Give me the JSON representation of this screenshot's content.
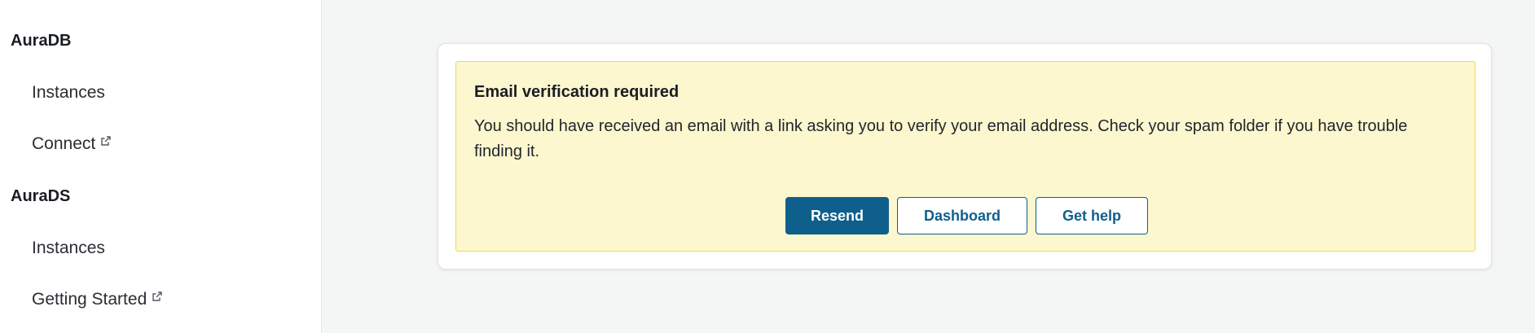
{
  "sidebar": {
    "sections": [
      {
        "heading": "AuraDB",
        "items": [
          {
            "label": "Instances",
            "external": false
          },
          {
            "label": "Connect",
            "external": true
          }
        ]
      },
      {
        "heading": "AuraDS",
        "items": [
          {
            "label": "Instances",
            "external": false
          },
          {
            "label": "Getting Started",
            "external": true
          }
        ]
      }
    ],
    "external_icon": "external-link-icon"
  },
  "main": {
    "banner": {
      "title": "Email verification required",
      "message": "You should have received an email with a link asking you to verify your email address. Check your spam folder if you have trouble finding it.",
      "buttons": {
        "resend": "Resend",
        "dashboard": "Dashboard",
        "help": "Get help"
      }
    }
  },
  "colors": {
    "primary": "#0e5f8c",
    "banner_background": "#fdf7cf",
    "banner_border": "#eed65a",
    "page_background": "#f4f5f5"
  }
}
